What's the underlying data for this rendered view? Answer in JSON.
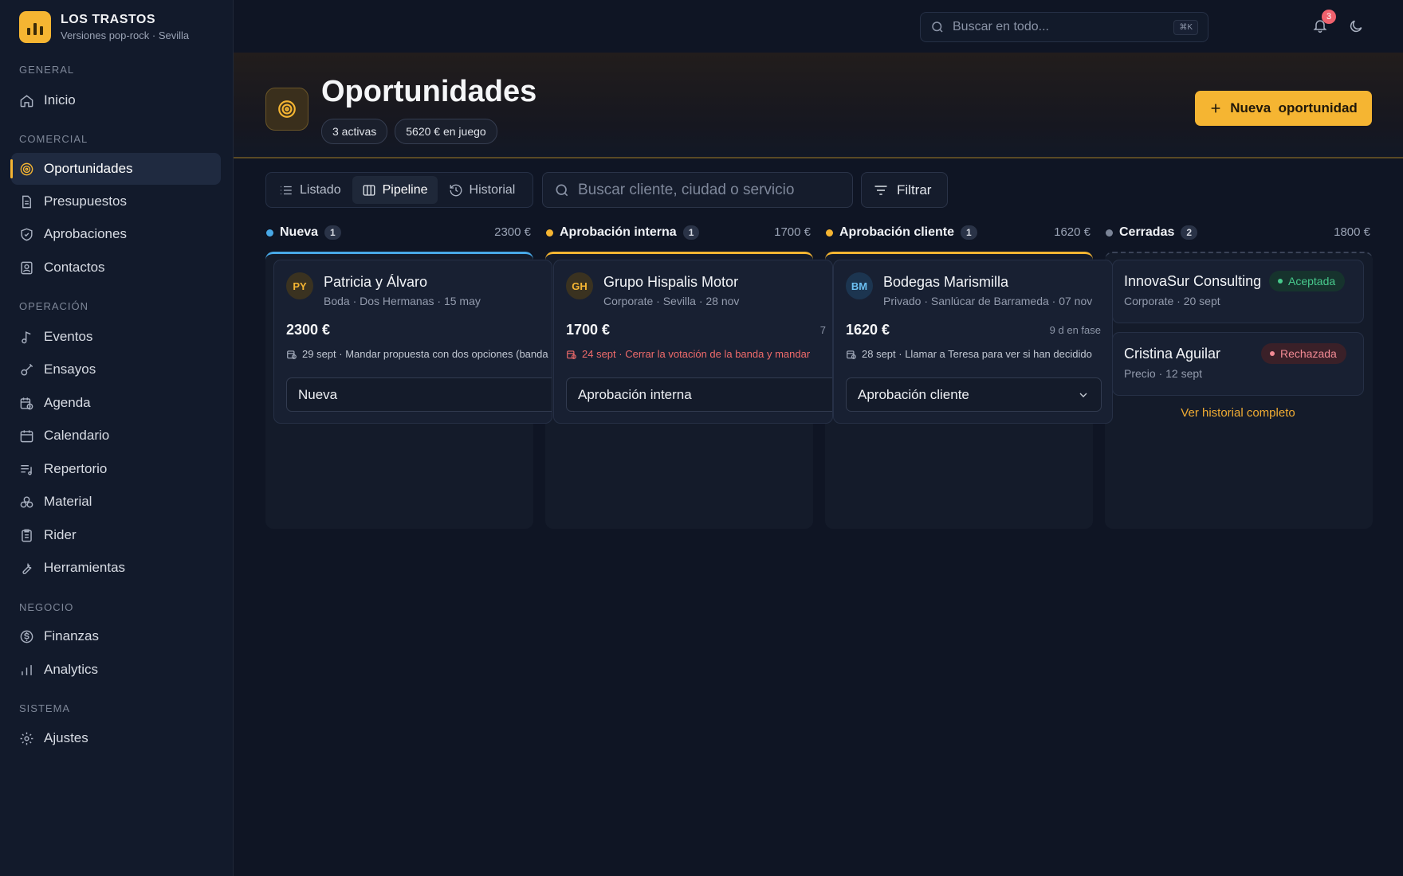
{
  "brand": {
    "name": "LOS TRASTOS",
    "subtitle": "Versiones pop-rock · Sevilla"
  },
  "sidebar": {
    "sections": {
      "general": "GENERAL",
      "comercial": "COMERCIAL",
      "operacion": "OPERACIÓN",
      "negocio": "NEGOCIO",
      "sistema": "SISTEMA"
    },
    "items": {
      "inicio": "Inicio",
      "oportunidades": "Oportunidades",
      "presupuestos": "Presupuestos",
      "aprobaciones": "Aprobaciones",
      "contactos": "Contactos",
      "eventos": "Eventos",
      "ensayos": "Ensayos",
      "agenda": "Agenda",
      "calendario": "Calendario",
      "repertorio": "Repertorio",
      "material": "Material",
      "rider": "Rider",
      "herramientas": "Herramientas",
      "finanzas": "Finanzas",
      "analytics": "Analytics",
      "ajustes": "Ajustes"
    },
    "active": "oportunidades"
  },
  "topbar": {
    "search_placeholder": "Buscar en todo...",
    "shortcut": "⌘K",
    "notifications_count": "3"
  },
  "header": {
    "title": "Oportunidades",
    "active_pill": "3 activas",
    "value_pill": "5620 € en juego",
    "new_button": "Nueva  oportunidad"
  },
  "toolbar": {
    "views": {
      "list": "Listado",
      "pipeline": "Pipeline",
      "history": "Historial"
    },
    "active_view": "pipeline",
    "search_placeholder": "Buscar cliente, ciudad o servicio",
    "filter_label": "Filtrar"
  },
  "columns": [
    {
      "name": "Nueva",
      "count": "1",
      "total": "2300 €",
      "color": "#48a8e6"
    },
    {
      "name": "Aprobación interna",
      "count": "1",
      "total": "1700 €",
      "color": "#f5b532"
    },
    {
      "name": "Aprobación cliente",
      "count": "1",
      "total": "1620 €",
      "color": "#f5b532"
    },
    {
      "name": "Cerradas",
      "count": "2",
      "total": "1800 €",
      "color": "#7b8497"
    }
  ],
  "cards": [
    {
      "initials": "PY",
      "name": "Patricia y Álvaro",
      "meta": "Boda · Dos Hermanas · 15 may",
      "amount": "2300 €",
      "days": "",
      "task": "29 sept · Mandar propuesta con dos opciones (banda",
      "stage": "Nueva",
      "overdue": false
    },
    {
      "initials": "GH",
      "name": "Grupo Hispalis Motor",
      "meta": "Corporate · Sevilla · 28 nov",
      "amount": "1700 €",
      "days": "7",
      "task": "24 sept · Cerrar la votación de la banda y mandar",
      "stage": "Aprobación interna",
      "overdue": true
    },
    {
      "initials": "BM",
      "name": "Bodegas Marismilla",
      "meta": "Privado · Sanlúcar de Barrameda · 07 nov",
      "amount": "1620 €",
      "days": "9 d en fase",
      "task": "28 sept · Llamar a Teresa para ver si han decidido",
      "stage": "Aprobación cliente",
      "overdue": false
    }
  ],
  "closed": [
    {
      "name": "InnovaSur Consulting",
      "meta": "Corporate · 20 sept",
      "status": "Aceptada"
    },
    {
      "name": "Cristina Aguilar",
      "meta": "Precio · 12 sept",
      "status": "Rechazada"
    }
  ],
  "history_link": "Ver historial completo",
  "colors": {
    "accent": "#f5b532",
    "nueva": "#48a8e6",
    "overdue": "#f06b6b",
    "accepted": "#47c98c",
    "rejected": "#f28a94"
  }
}
